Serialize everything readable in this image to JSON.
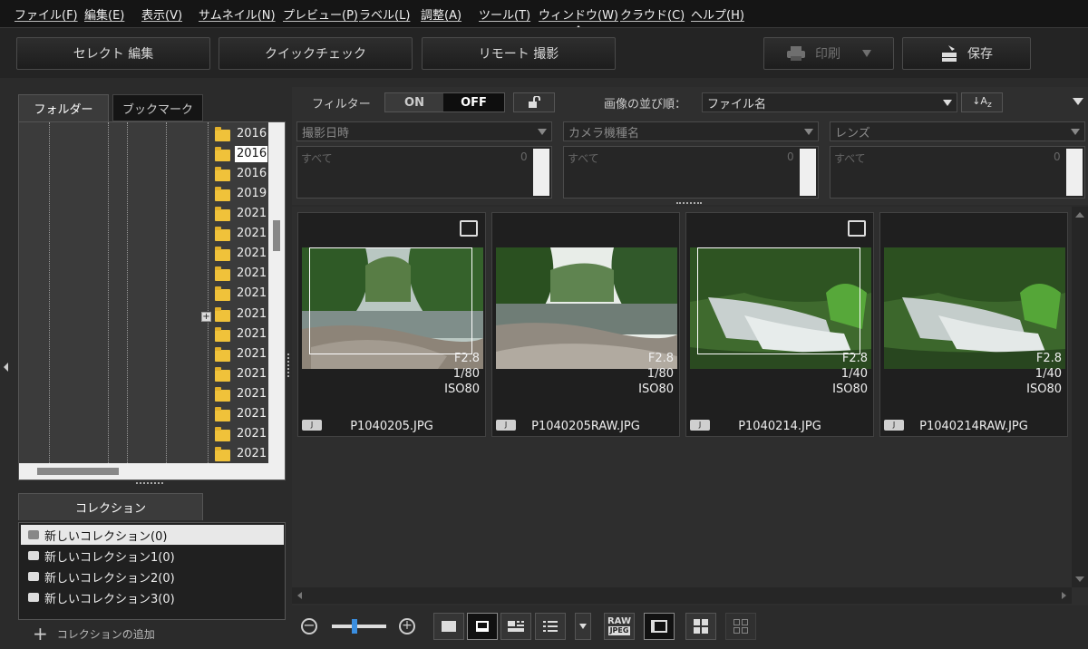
{
  "menubar": {
    "items": [
      "ファイル(F)",
      "編集(E)",
      "表示(V)",
      "サムネイル(N)",
      "プレビュー(P)",
      "ラベル(L)",
      "調整(A)",
      "ツール(T)",
      "ウィンドウ(W)",
      "クラウド(C)",
      "ヘルプ(H)"
    ]
  },
  "toolbar": {
    "select_edit": "セレクト 編集",
    "quick_check": "クイックチェック",
    "remote_shoot": "リモート 撮影",
    "print": "印刷",
    "save": "保存"
  },
  "left_panel": {
    "tabs": [
      "フォルダー",
      "ブックマーク"
    ],
    "tree_items": [
      "2016",
      "2016",
      "2016",
      "2019",
      "2021",
      "2021",
      "2021",
      "2021",
      "2021",
      "2021",
      "2021",
      "2021",
      "2021",
      "2021",
      "2021",
      "2021",
      "2021"
    ],
    "collections_tab": "コレクション",
    "collections": [
      "新しいコレクション(0)",
      "新しいコレクション1(0)",
      "新しいコレクション2(0)",
      "新しいコレクション3(0)"
    ],
    "add_collection": "コレクションの追加"
  },
  "filter": {
    "label": "フィルター",
    "on": "ON",
    "off": "OFF",
    "sort_label": "画像の並び順：",
    "sort_value": "ファイル名",
    "dropdowns": [
      "撮影日時",
      "カメラ機種名",
      "レンズ"
    ],
    "lists": [
      {
        "item": "すべて",
        "count": "0"
      },
      {
        "item": "すべて",
        "count": "0"
      },
      {
        "item": "すべて",
        "count": "0"
      }
    ]
  },
  "thumbnails": [
    {
      "name": "P1040205.JPG",
      "aperture": "F2.8",
      "shutter": "1/80",
      "iso": "ISO80",
      "badge": "J",
      "selected": true,
      "expand": true
    },
    {
      "name": "P1040205RAW.JPG",
      "aperture": "F2.8",
      "shutter": "1/80",
      "iso": "ISO80",
      "badge": "J",
      "selected": false,
      "expand": false
    },
    {
      "name": "P1040214.JPG",
      "aperture": "F2.8",
      "shutter": "1/40",
      "iso": "ISO80",
      "badge": "J",
      "selected": true,
      "expand": true
    },
    {
      "name": "P1040214RAW.JPG",
      "aperture": "F2.8",
      "shutter": "1/40",
      "iso": "ISO80",
      "badge": "J",
      "selected": false,
      "expand": false
    }
  ],
  "bottombar": {
    "raw_top": "RAW",
    "raw_bottom": "JPEG"
  },
  "colors": {
    "accent": "#ffffff",
    "folder": "#f0c23a",
    "slider": "#3a8ee0"
  }
}
